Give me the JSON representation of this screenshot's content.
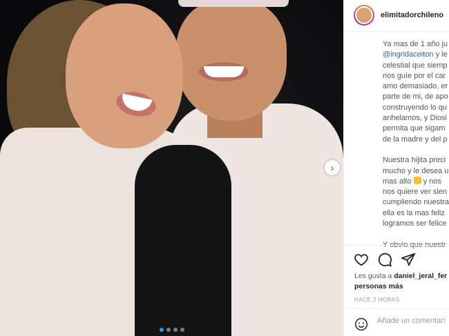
{
  "post": {
    "username": "elimitadorchileno",
    "caption_lines": [
      "Ya mas de 1 año ju",
      "@ingridaceiton y le",
      "celestial que siemp",
      "nos guíe por el car",
      "amo demasiado, er",
      "parte de mi, de apo",
      "construyendo lo qu",
      "anhelamos, y Diosi",
      "permita que sigam",
      "de la madre y del p",
      "",
      "Nuestra hijita preci",
      "mucho y le desea u",
      "mas alto",
      "nos quiere ver sien",
      "cumpliendo nuestra",
      "ella es la mas feliz",
      "logramos ser felice",
      "",
      "Y obvio que nuestr"
    ],
    "caption_line2_mention": "@ingridaceiton",
    "caption_line2_rest": " y le",
    "caption_line14_suffix": " y nos",
    "likes_prefix": "Les gusta a ",
    "likes_user": "daniel_jeral_fer",
    "likes_suffix": "personas más",
    "timestamp": "HACE 2 HORAS",
    "comment_placeholder": "Añade un comentari",
    "carousel": {
      "total": 4,
      "active_index": 0
    }
  },
  "icons": {
    "like": "heart-icon",
    "comment": "comment-icon",
    "share": "share-icon",
    "next": "chevron-right-icon",
    "emoji": "smiley-icon"
  },
  "colors": {
    "mention": "#3b5b94",
    "active_dot": "#3897f0"
  }
}
